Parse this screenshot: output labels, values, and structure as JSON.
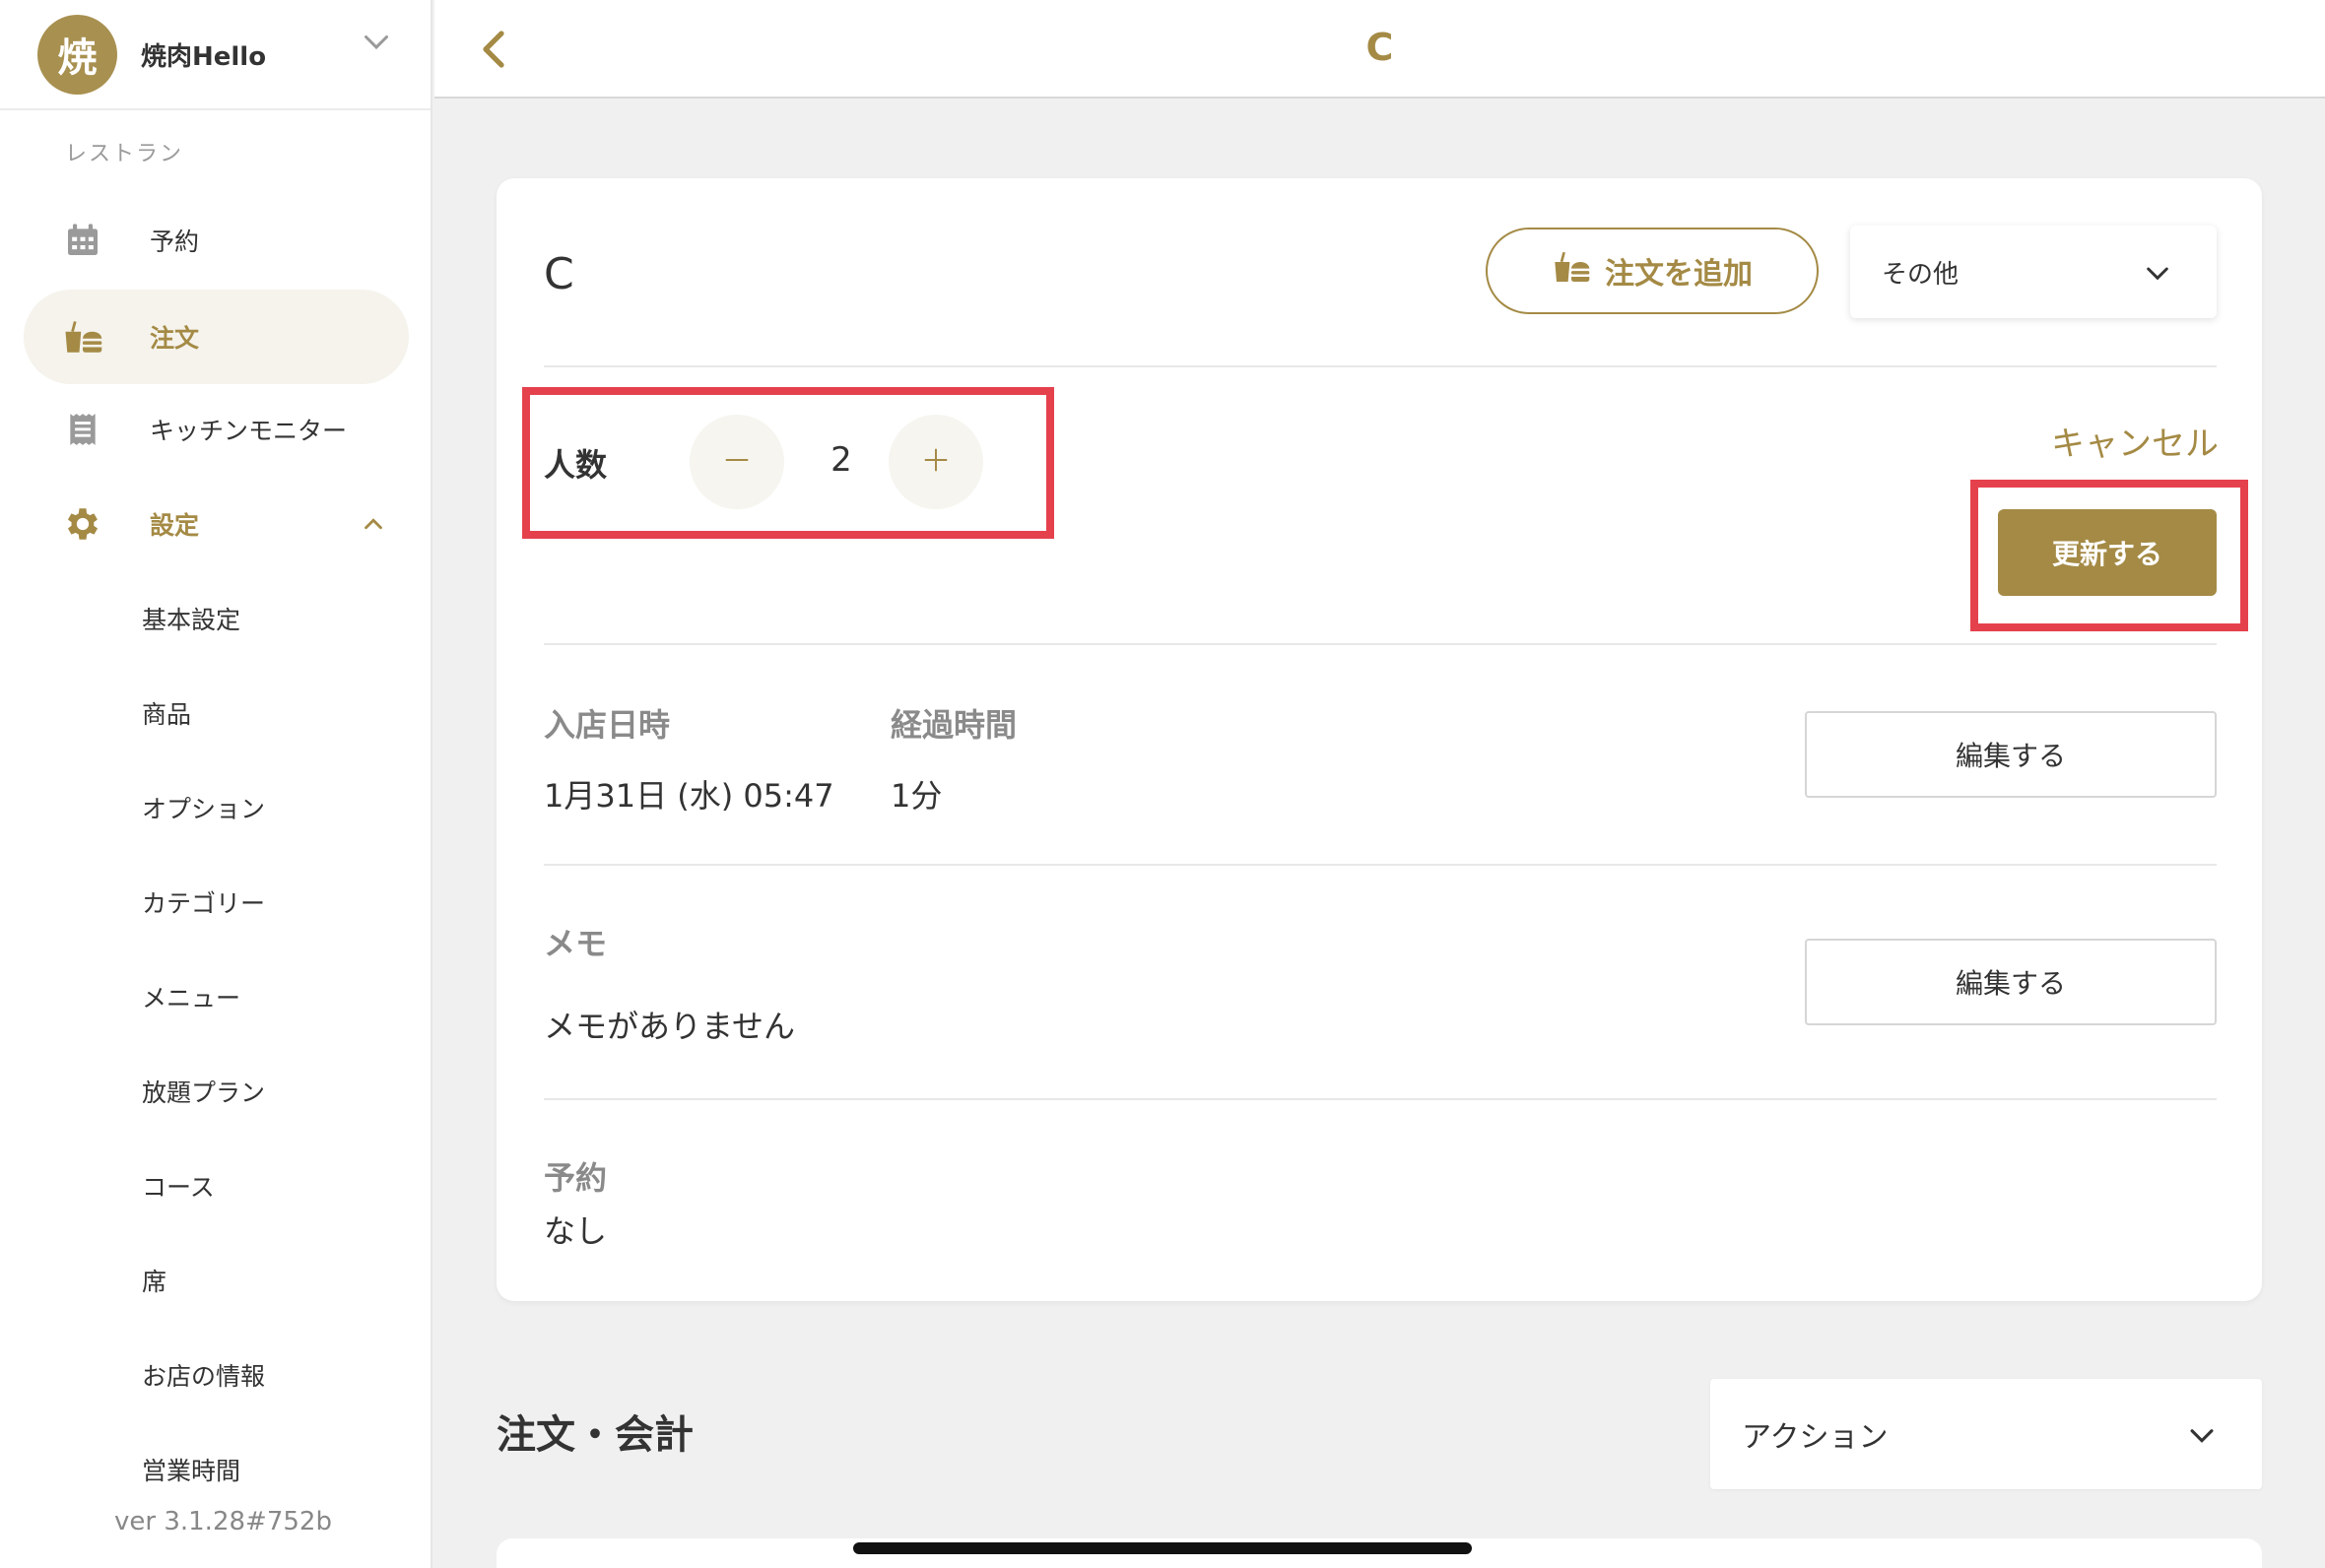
{
  "sidebar": {
    "avatar_char": "焼",
    "shop_name": "焼肉Hello",
    "section_label": "レストラン",
    "nav": {
      "reservation": "予約",
      "order": "注文",
      "kitchen_monitor": "キッチンモニター",
      "settings": "設定"
    },
    "settings_items": [
      "基本設定",
      "商品",
      "オプション",
      "カテゴリー",
      "メニュー",
      "放題プラン",
      "コース",
      "席",
      "お店の情報",
      "営業時間"
    ],
    "version": "ver 3.1.28#752b"
  },
  "topbar": {
    "title": "C"
  },
  "card": {
    "title": "C",
    "add_order_label": "注文を追加",
    "other_select_value": "その他",
    "people_label": "人数",
    "people_count": "2",
    "cancel_label": "キャンセル",
    "update_label": "更新する",
    "entry_time_label": "入店日時",
    "entry_time_value": "1月31日 (水) 05:47",
    "elapsed_label": "経過時間",
    "elapsed_value": "1分",
    "edit_label": "編集する",
    "memo_label": "メモ",
    "memo_value": "メモがありません",
    "reservation_label": "予約",
    "reservation_value": "なし"
  },
  "lower": {
    "section_title": "注文・会計",
    "action_select_value": "アクション"
  },
  "colors": {
    "accent": "#a48a45",
    "highlight": "#e5414d",
    "background": "#f0f0f0"
  }
}
